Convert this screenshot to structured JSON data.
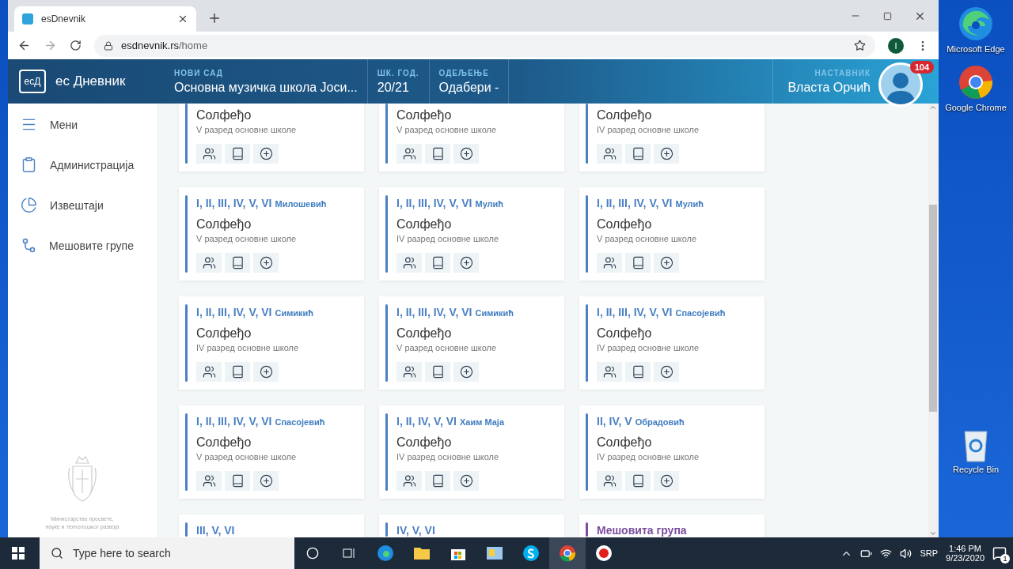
{
  "browser": {
    "tab_title": "esDnevnik",
    "url_domain": "esdnevnik.rs",
    "url_path": "/home",
    "profile": "I"
  },
  "header": {
    "logo": "есД",
    "brand": "ес Дневник",
    "fields": [
      {
        "label": "НОВИ САД",
        "value": "Основна музичка школа Јоси..."
      },
      {
        "label": "ШК. ГОД.",
        "value": "20/21"
      },
      {
        "label": "ОДЕЉЕЊЕ",
        "value": "Одабери -"
      }
    ],
    "user": {
      "label": "НАСТАВНИК",
      "name": "Власта Орчић",
      "badge": "104"
    }
  },
  "sidebar": {
    "items": [
      {
        "label": "Мени"
      },
      {
        "label": "Администрација"
      },
      {
        "label": "Извештаји"
      },
      {
        "label": "Мешовите групе"
      }
    ],
    "ministry": [
      "Министарство просвете,",
      "науке и технолошког развоја"
    ]
  },
  "cards": [
    {
      "subject": "Солфеђо",
      "grade": "V разред основне школе",
      "color": "#4a80c4"
    },
    {
      "subject": "Солфеђо",
      "grade": "V разред основне школе",
      "color": "#4a80c4"
    },
    {
      "subject": "Солфеђо",
      "grade": "IV разред основне школе",
      "color": "#4a80c4"
    },
    {
      "classes": "I, II, III, IV, V, VI",
      "teacher": "Милошевић",
      "subject": "Солфеђо",
      "grade": "V разред основне школе",
      "color": "#4a80c4"
    },
    {
      "classes": "I, II, III, IV, V, VI",
      "teacher": "Мулић",
      "subject": "Солфеђо",
      "grade": "IV разред основне школе",
      "color": "#4a80c4"
    },
    {
      "classes": "I, II, III, IV, V, VI",
      "teacher": "Мулић",
      "subject": "Солфеђо",
      "grade": "V разред основне школе",
      "color": "#4a80c4"
    },
    {
      "classes": "I, II, III, IV, V, VI",
      "teacher": "Симикић",
      "subject": "Солфеђо",
      "grade": "IV разред основне школе",
      "color": "#4a80c4"
    },
    {
      "classes": "I, II, III, IV, V, VI",
      "teacher": "Симикић",
      "subject": "Солфеђо",
      "grade": "V разред основне школе",
      "color": "#4a80c4"
    },
    {
      "classes": "I, II, III, IV, V, VI",
      "teacher": "Спасојевић",
      "subject": "Солфеђо",
      "grade": "IV разред основне школе",
      "color": "#4a80c4"
    },
    {
      "classes": "I, II, III, IV, V, VI",
      "teacher": "Спасојевић",
      "subject": "Солфеђо",
      "grade": "V разред основне школе",
      "color": "#4a80c4"
    },
    {
      "classes": "I, II, IV, V, VI",
      "teacher": "Хаим Маја",
      "subject": "Солфеђо",
      "grade": "IV разред основне школе",
      "color": "#4a80c4"
    },
    {
      "classes": "II, IV, V",
      "teacher": "Обрадовић",
      "subject": "Солфеђо",
      "grade": "IV разред основне школе",
      "color": "#4a80c4"
    },
    {
      "classes": "III, V, VI",
      "color": "#4a80c4"
    },
    {
      "classes": "IV, V, VI",
      "color": "#4a80c4"
    },
    {
      "classes": "Мешовита група",
      "color": "#7a4d9e"
    }
  ],
  "desktop_icons": [
    {
      "label": "Microsoft Edge"
    },
    {
      "label": "Google Chrome"
    },
    {
      "label": "Recycle Bin"
    }
  ],
  "taskbar": {
    "search_placeholder": "Type here to search",
    "language": "SRP",
    "time": "1:46 PM",
    "date": "9/23/2020",
    "notifications": "1"
  }
}
